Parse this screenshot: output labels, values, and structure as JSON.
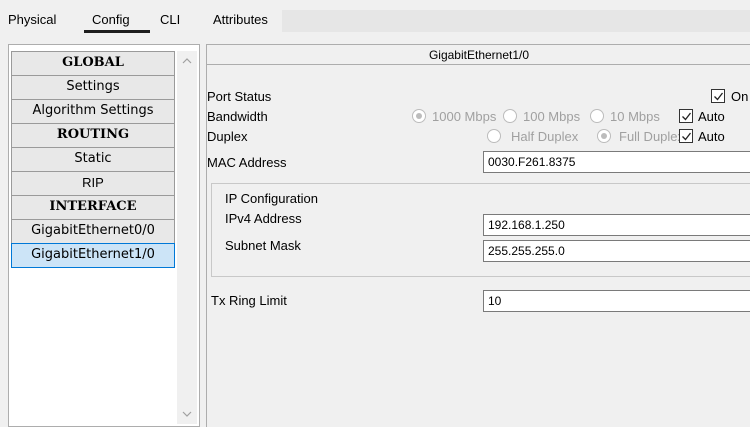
{
  "tabs": [
    "Physical",
    "Config",
    "CLI",
    "Attributes"
  ],
  "sidebar": {
    "items": [
      {
        "label": "GLOBAL",
        "type": "header"
      },
      {
        "label": "Settings",
        "type": "item"
      },
      {
        "label": "Algorithm Settings",
        "type": "item"
      },
      {
        "label": "ROUTING",
        "type": "header"
      },
      {
        "label": "Static",
        "type": "item"
      },
      {
        "label": "RIP",
        "type": "item"
      },
      {
        "label": "INTERFACE",
        "type": "header"
      },
      {
        "label": "GigabitEthernet0/0",
        "type": "item"
      },
      {
        "label": "GigabitEthernet1/0",
        "type": "item",
        "selected": true
      }
    ]
  },
  "main": {
    "title": "GigabitEthernet1/0",
    "port_status_label": "Port Status",
    "port_status_on_label": "On",
    "bandwidth_label": "Bandwidth",
    "bandwidth_options": [
      "1000 Mbps",
      "100 Mbps",
      "10 Mbps"
    ],
    "bandwidth_auto_label": "Auto",
    "duplex_label": "Duplex",
    "duplex_options": [
      "Half Duplex",
      "Full Duplex"
    ],
    "duplex_auto_label": "Auto",
    "mac_label": "MAC Address",
    "mac_value": "0030.F261.8375",
    "ip_config_title": "IP Configuration",
    "ipv4_label": "IPv4 Address",
    "ipv4_value": "192.168.1.250",
    "subnet_label": "Subnet Mask",
    "subnet_value": "255.255.255.0",
    "tx_ring_label": "Tx Ring Limit",
    "tx_ring_value": "10"
  },
  "colors": {
    "selected_bg": "#cce4f7",
    "selected_border": "#0078d7",
    "disabled_text": "#a0a0a0"
  }
}
